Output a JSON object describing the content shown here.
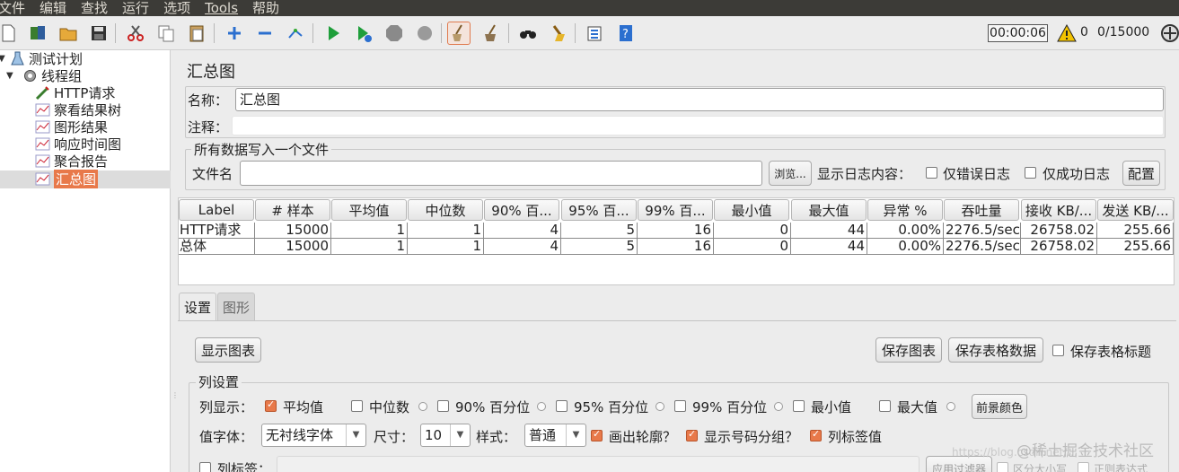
{
  "menu": [
    "文件",
    "编辑",
    "查找",
    "运行",
    "选项",
    "Tools",
    "帮助"
  ],
  "toolbar": {
    "icons": [
      "new-icon",
      "templates-icon",
      "open-icon",
      "save-icon",
      "cut-icon",
      "copy-icon",
      "paste-icon",
      "expand-icon",
      "collapse-icon",
      "toggle-icon",
      "start-icon",
      "start-no-pause-icon",
      "stop-icon",
      "shutdown-icon",
      "clear-icon",
      "clear-all-icon",
      "search-icon",
      "reset-search-icon",
      "function-helper-icon",
      "help-icon"
    ],
    "timer": "00:00:06",
    "warning_count": "0",
    "thread_count": "0/15000",
    "accent": "#e07b4f"
  },
  "tree": {
    "items": [
      {
        "label": "测试计划",
        "icon": "test-plan-icon"
      },
      {
        "label": "线程组",
        "icon": "gear-icon"
      },
      {
        "label": "HTTP请求",
        "icon": "sampler-icon"
      },
      {
        "label": "察看结果树",
        "icon": "listener-icon"
      },
      {
        "label": "图形结果",
        "icon": "listener-icon"
      },
      {
        "label": "响应时间图",
        "icon": "listener-icon"
      },
      {
        "label": "聚合报告",
        "icon": "listener-icon"
      },
      {
        "label": "汇总图",
        "icon": "listener-icon",
        "selected": true
      }
    ]
  },
  "panel": {
    "title": "汇总图",
    "name_label": "名称：",
    "name_value": "汇总图",
    "comment_label": "注释：",
    "file_group_title": "所有数据写入一个文件",
    "filename_label": "文件名",
    "filename_value": "",
    "browse_label": "浏览...",
    "log_label": "显示日志内容：",
    "errors_only_label": "仅错误日志",
    "success_only_label": "仅成功日志",
    "configure_label": "配置"
  },
  "table": {
    "headers": [
      "Label",
      "# 样本",
      "平均值",
      "中位数",
      "90% 百...",
      "95% 百...",
      "99% 百...",
      "最小值",
      "最大值",
      "异常 %",
      "吞吐量",
      "接收 KB/...",
      "发送 KB/..."
    ],
    "rows": [
      [
        "HTTP请求",
        "15000",
        "1",
        "1",
        "4",
        "5",
        "16",
        "0",
        "44",
        "0.00%",
        "2276.5/sec",
        "26758.02",
        "255.66"
      ],
      [
        "总体",
        "15000",
        "1",
        "1",
        "4",
        "5",
        "16",
        "0",
        "44",
        "0.00%",
        "2276.5/sec",
        "26758.02",
        "255.66"
      ]
    ]
  },
  "tabs": [
    "设置",
    "图形"
  ],
  "settings": {
    "show_chart_label": "显示图表",
    "save_chart_label": "保存图表",
    "save_table_label": "保存表格数据",
    "save_table_header_label": "保存表格标题",
    "column_group_title": "列设置",
    "column_show_label": "列显示：",
    "columns": [
      {
        "label": "平均值",
        "checked": true
      },
      {
        "label": "中位数",
        "checked": false
      },
      {
        "label": "90% 百分位",
        "checked": false
      },
      {
        "label": "95% 百分位",
        "checked": false
      },
      {
        "label": "99% 百分位",
        "checked": false
      },
      {
        "label": "最小值",
        "checked": false
      },
      {
        "label": "最大值",
        "checked": false
      }
    ],
    "foreground_color_label": "前景颜色",
    "value_font_label": "值字体：",
    "value_font_value": "无衬线字体",
    "size_label": "尺寸：",
    "size_value": "10",
    "style_label": "样式：",
    "style_value": "普通",
    "draw_outline_label": "画出轮廓？",
    "show_number_grouping_label": "显示号码分组？",
    "column_label_value_label": "列标签值",
    "column_label_label": "列标签：",
    "apply_filter_label": "应用过滤器",
    "case_sensitive_label": "区分大小写",
    "regex_label": "正则表达式"
  },
  "watermark": "@稀土掘金技术社区",
  "watermark_url": "https://blog.csdn.net/..."
}
